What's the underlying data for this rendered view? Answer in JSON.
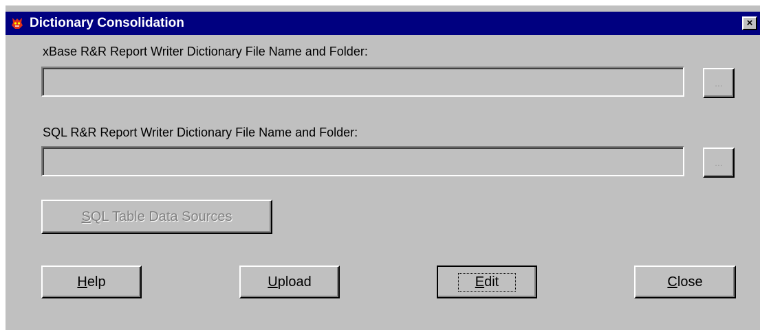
{
  "window": {
    "title": "Dictionary Consolidation",
    "close_label": "×"
  },
  "xbase": {
    "label": "xBase R&R Report Writer Dictionary File Name and Folder:",
    "value": "",
    "browse_label": "..."
  },
  "sql": {
    "label": "SQL R&R Report Writer Dictionary File Name and Folder:",
    "value": "",
    "browse_label": "..."
  },
  "sources_button": {
    "mnemonic": "S",
    "rest": "QL Table Data Sources"
  },
  "buttons": {
    "help": {
      "mnemonic": "H",
      "rest": "elp"
    },
    "upload": {
      "mnemonic": "U",
      "rest": "pload"
    },
    "edit": {
      "mnemonic": "E",
      "rest": "dit"
    },
    "close": {
      "mnemonic": "C",
      "rest": "lose"
    }
  }
}
